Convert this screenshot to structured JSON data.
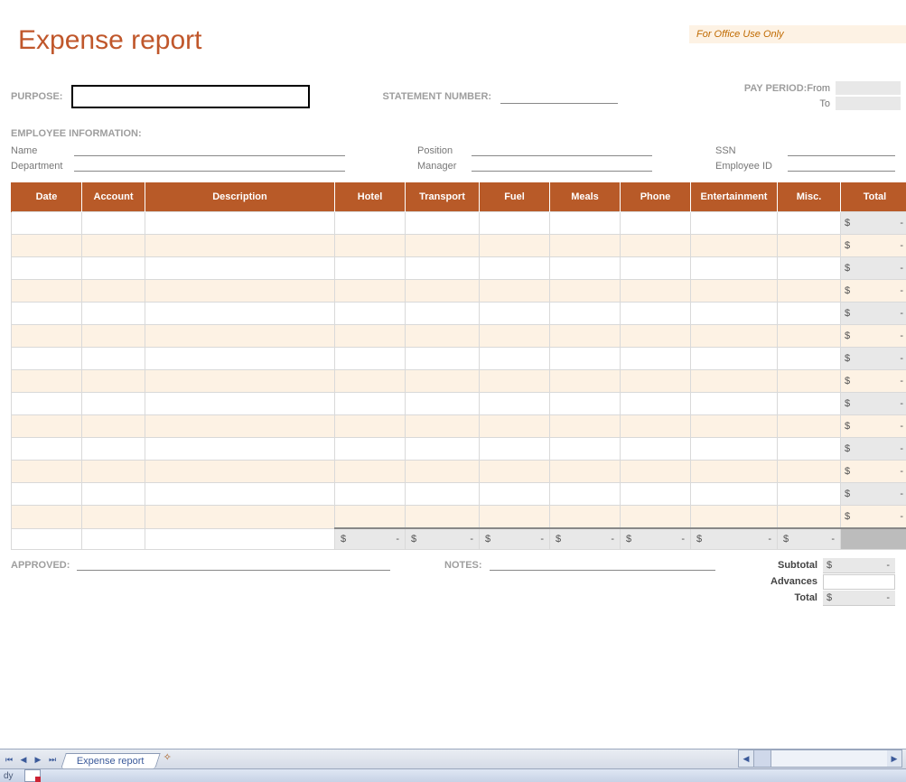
{
  "office_use": "For Office Use Only",
  "title": "Expense report",
  "labels": {
    "purpose": "PURPOSE:",
    "statement": "STATEMENT NUMBER:",
    "pay_period": "PAY PERIOD:",
    "from": "From",
    "to": "To",
    "employee_info": "EMPLOYEE INFORMATION:",
    "name": "Name",
    "position": "Position",
    "ssn": "SSN",
    "department": "Department",
    "manager": "Manager",
    "employee_id": "Employee ID",
    "approved": "APPROVED:",
    "notes": "NOTES:"
  },
  "table": {
    "headers": [
      "Date",
      "Account",
      "Description",
      "Hotel",
      "Transport",
      "Fuel",
      "Meals",
      "Phone",
      "Entertainment",
      "Misc.",
      "Total"
    ],
    "row_count": 14,
    "currency": "$",
    "dash": "-",
    "sum_cols": 7
  },
  "summary": {
    "subtotal": "Subtotal",
    "advances": "Advances",
    "total": "Total",
    "currency": "$",
    "dash": "-"
  },
  "tabs": {
    "sheet": "Expense report",
    "status": "dy"
  }
}
